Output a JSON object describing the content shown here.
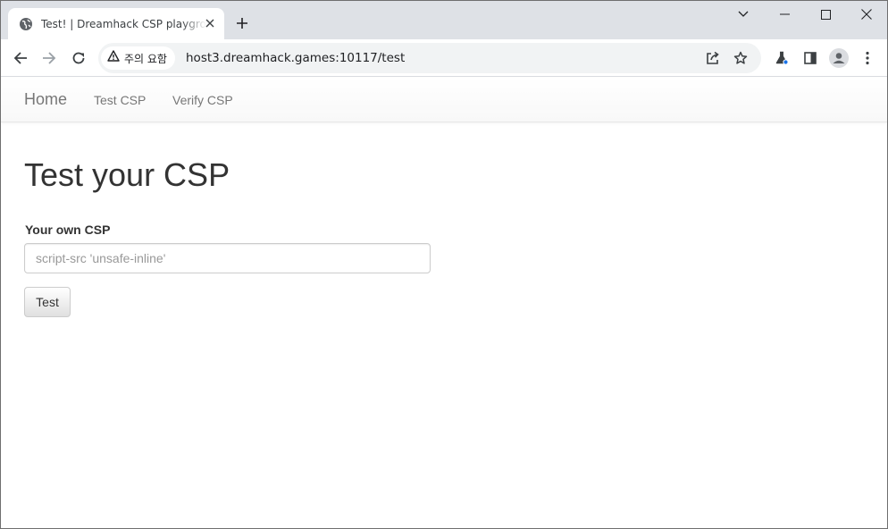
{
  "browser": {
    "tab": {
      "title": "Test! | Dreamhack CSP playground",
      "favicon": "globe-icon"
    },
    "security_chip": {
      "icon": "warning-icon",
      "label": "주의 요함"
    },
    "address": "host3.dreamhack.games:10117/test",
    "colors": {
      "tabstrip": "#dee1e6",
      "omnibox": "#f1f3f4",
      "profile_badge": "#1a73e8"
    }
  },
  "navbar": {
    "brand": "Home",
    "links": [
      "Test CSP",
      "Verify CSP"
    ]
  },
  "main": {
    "heading": "Test your CSP",
    "csp_label": "Your own CSP",
    "csp_input": {
      "value": "",
      "placeholder": "script-src 'unsafe-inline'"
    },
    "submit_label": "Test"
  }
}
